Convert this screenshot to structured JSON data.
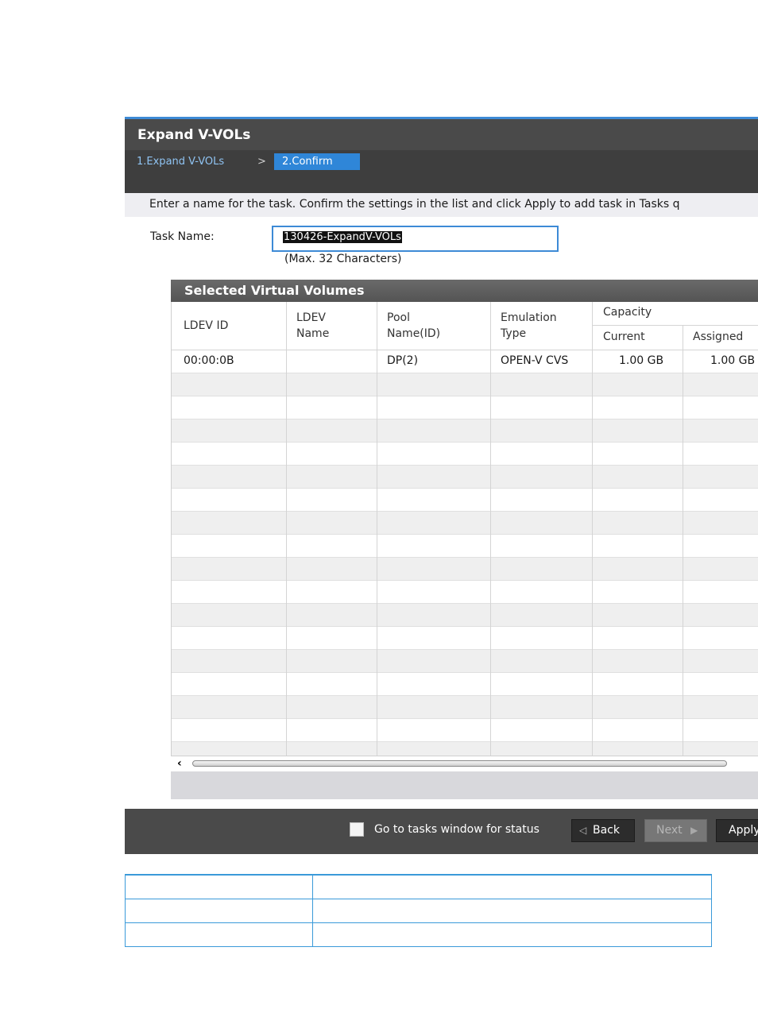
{
  "dialog": {
    "title": "Expand V-VOLs",
    "steps": {
      "step1": "1.Expand V-VOLs",
      "separator": ">",
      "step2": "2.Confirm"
    },
    "instruction": "Enter a name for the task. Confirm the settings in the list and click Apply to add task in Tasks q",
    "task_name_label": "Task Name:",
    "task_name_value": "130426-ExpandV-VOLs",
    "task_name_hint": "(Max. 32 Characters)"
  },
  "table": {
    "title": "Selected Virtual Volumes",
    "headers": {
      "ldev_id": "LDEV ID",
      "ldev_name_1": "LDEV",
      "ldev_name_2": "Name",
      "pool_1": "Pool",
      "pool_2": "Name(ID)",
      "emulation_1": "Emulation",
      "emulation_2": "Type",
      "capacity": "Capacity",
      "current": "Current",
      "assigned": "Assigned"
    },
    "row": {
      "ldev_id": "00:00:0B",
      "ldev_name": "",
      "pool": "DP(2)",
      "emulation": "OPEN-V CVS",
      "current": "1.00 GB",
      "assigned": "1.00 GB"
    }
  },
  "footer": {
    "checkbox_label": "Go to tasks window for status",
    "back_label": "Back",
    "next_label": "Next",
    "apply_label": "Apply",
    "back_icon": "chevron-left-icon",
    "next_icon": "triangle-right-icon"
  },
  "colors": {
    "title_bar": "#4a4a4a",
    "wizard_bar": "#3e3e3e",
    "active_step": "#2f86d8",
    "input_border": "#3d8ad6",
    "doc_table_border": "#3a9ad9"
  }
}
